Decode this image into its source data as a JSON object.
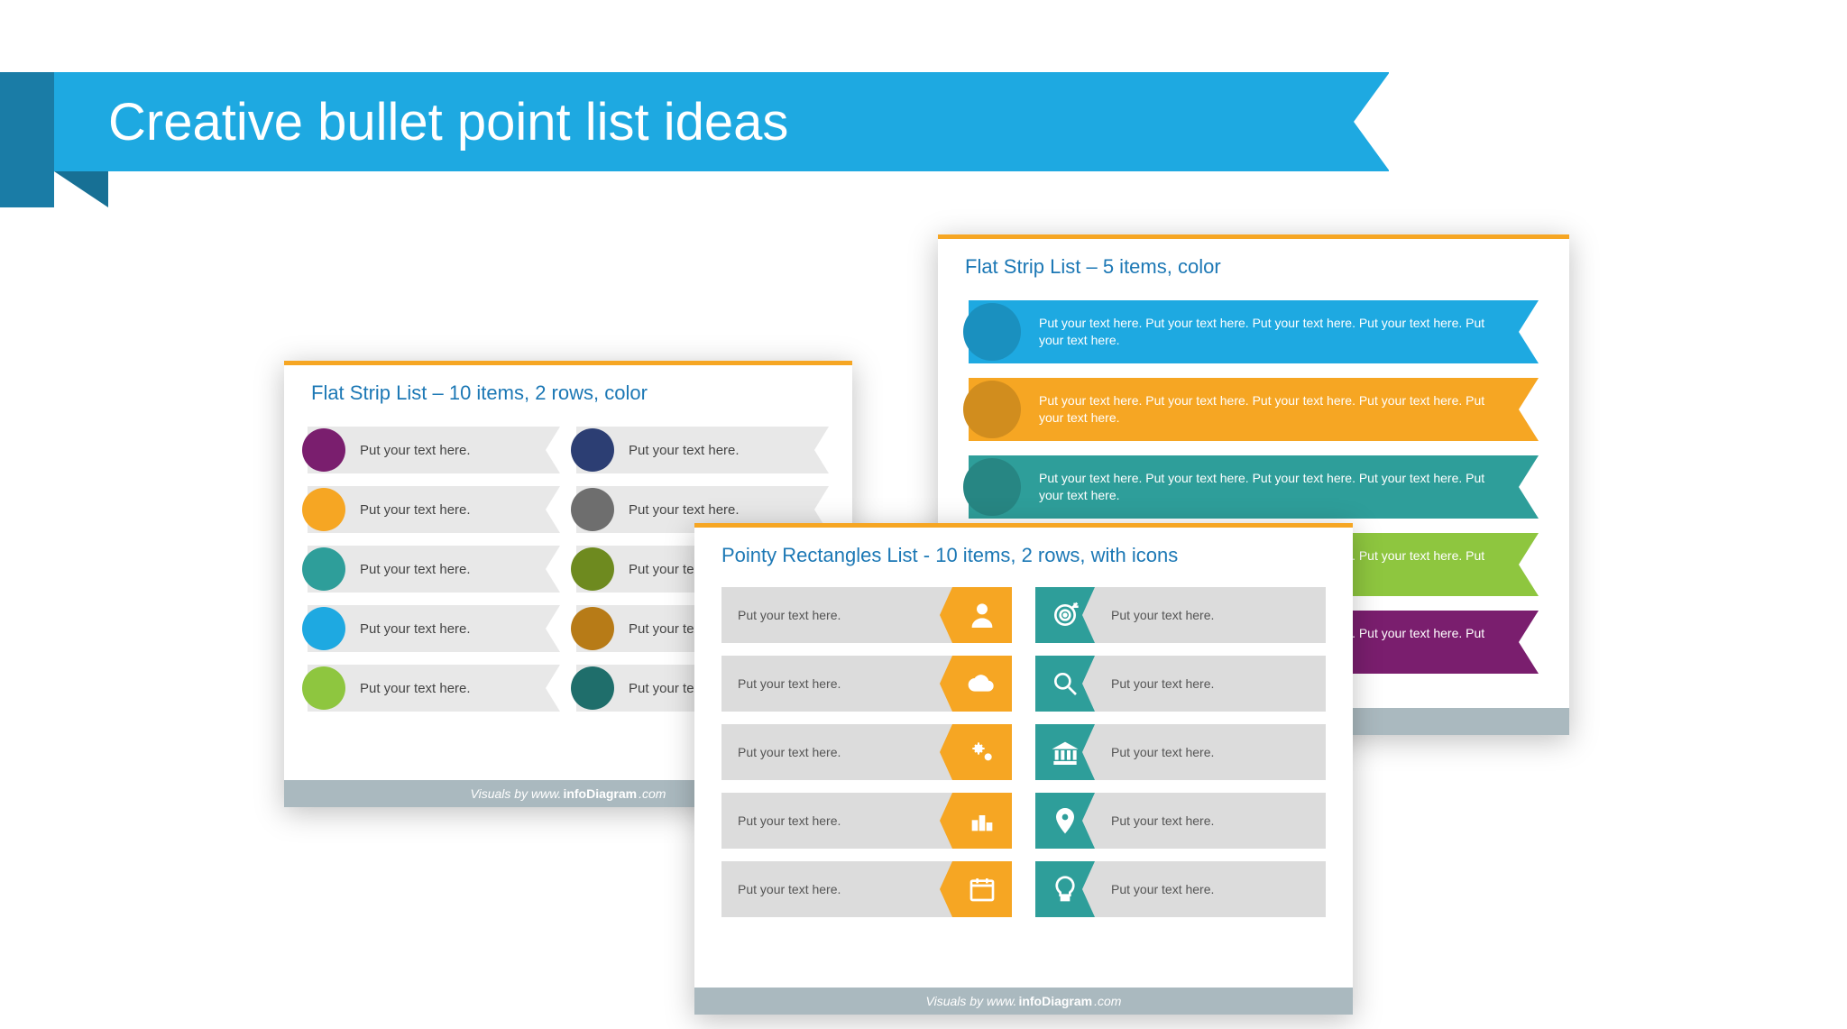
{
  "title": "Creative bullet point list ideas",
  "footer_prefix": "Visuals by www.",
  "footer_brand": "infoDiagram",
  "footer_suffix": ".com",
  "slideA": {
    "title": "Flat Strip List – 10 items, 2 rows, color",
    "placeholder": "Put your text here.",
    "colors_left": [
      "#7a1e6e",
      "#f6a623",
      "#2e9e9a",
      "#1ea9e1",
      "#8ec63f"
    ],
    "colors_right": [
      "#2c3e73",
      "#6e6e6e",
      "#6e8a1f",
      "#b77b17",
      "#1f6e6b"
    ]
  },
  "slideB": {
    "title": "Flat Strip List – 5 items, color",
    "placeholder": "Put your text here. Put your text here. Put your text here. Put your text here. Put your text here.",
    "colors": [
      "#1ea9e1",
      "#f6a623",
      "#2e9e9a",
      "#8ec63f",
      "#7a1e6e"
    ]
  },
  "slideC": {
    "title": "Pointy Rectangles List - 10 items, 2 rows, with icons",
    "placeholder": "Put your text here.",
    "left_color": "#f6a623",
    "right_color": "#2e9e9a",
    "left_icons": [
      "person-icon",
      "cloud-icon",
      "gears-icon",
      "bar-chart-icon",
      "calendar-icon"
    ],
    "right_icons": [
      "target-icon",
      "magnifier-icon",
      "bank-icon",
      "location-icon",
      "lightbulb-icon"
    ]
  }
}
